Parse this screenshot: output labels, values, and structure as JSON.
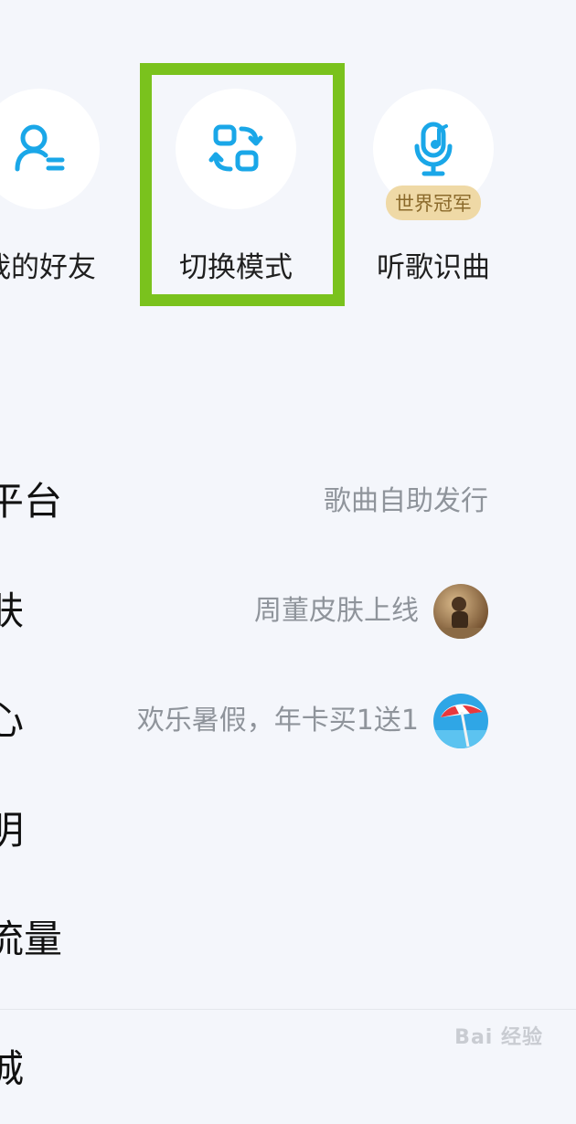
{
  "shortcuts": [
    {
      "label": "我的好友",
      "icon": "friends-icon"
    },
    {
      "label": "切换模式",
      "icon": "switch-mode-icon"
    },
    {
      "label": "听歌识曲",
      "icon": "music-recognition-icon",
      "badge": "世界冠军"
    }
  ],
  "list": [
    {
      "label": "平台",
      "right": "歌曲自助发行"
    },
    {
      "label": "肤",
      "right": "周董皮肤上线",
      "thumb": "skin-avatar"
    },
    {
      "label": "心",
      "right": "欢乐暑假，年卡买1送1",
      "thumb": "beach-umbrella"
    },
    {
      "label": "明",
      "right": ""
    },
    {
      "label": "流量",
      "right": ""
    },
    {
      "label": "城",
      "right": ""
    }
  ],
  "watermark": "Bai 经验",
  "colors": {
    "accent": "#1aa7e8",
    "highlight": "#7ac21d",
    "badge_bg": "#efd9a6"
  }
}
